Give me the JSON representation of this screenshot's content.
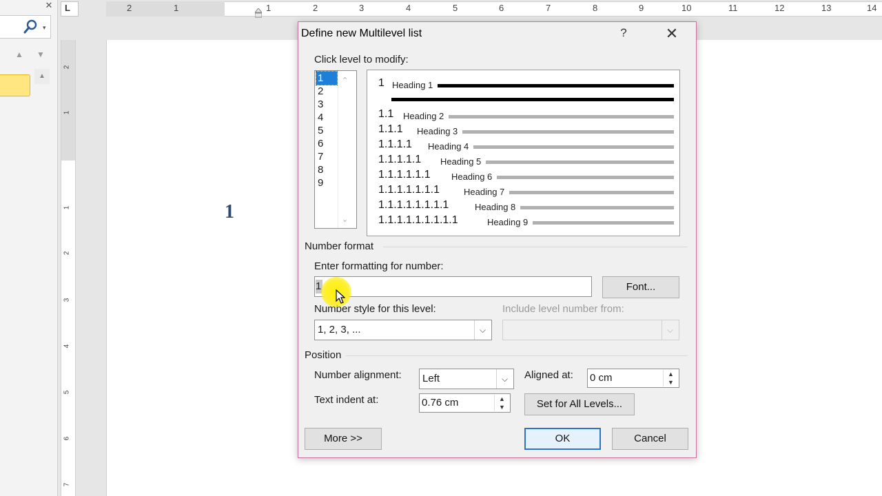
{
  "nav": {
    "close_glyph": "✕",
    "search_arrow": "▾",
    "up_glyph": "▲",
    "down_glyph": "▼",
    "scroll_up_glyph": "▲"
  },
  "ruler": {
    "corner_glyph": "L",
    "horizontal_numbers": [
      "2",
      "1",
      "1",
      "2",
      "3",
      "4",
      "5",
      "6",
      "7",
      "8",
      "9",
      "10",
      "11",
      "12",
      "13",
      "14"
    ],
    "vertical_numbers": [
      "2",
      "1",
      "1",
      "2",
      "3",
      "4",
      "5",
      "6",
      "7"
    ]
  },
  "document": {
    "heading_number": "1"
  },
  "dialog": {
    "title": "Define new Multilevel list",
    "help_glyph": "?",
    "close_glyph": "✕",
    "click_level_label": "Click level to modify:",
    "levels": [
      "1",
      "2",
      "3",
      "4",
      "5",
      "6",
      "7",
      "8",
      "9"
    ],
    "selected_level": "1",
    "scroll_up_glyph": "⌃",
    "scroll_down_glyph": "⌄",
    "preview": [
      {
        "number": "1",
        "heading": "Heading 1"
      },
      {
        "number": "1.1",
        "heading": "Heading 2"
      },
      {
        "number": "1.1.1",
        "heading": "Heading 3"
      },
      {
        "number": "1.1.1.1",
        "heading": "Heading 4"
      },
      {
        "number": "1.1.1.1.1",
        "heading": "Heading 5"
      },
      {
        "number": "1.1.1.1.1.1",
        "heading": "Heading 6"
      },
      {
        "number": "1.1.1.1.1.1.1",
        "heading": "Heading 7"
      },
      {
        "number": "1.1.1.1.1.1.1.1",
        "heading": "Heading 8"
      },
      {
        "number": "1.1.1.1.1.1.1.1.1",
        "heading": "Heading 9"
      }
    ],
    "number_format_section": "Number format",
    "enter_formatting_label": "Enter formatting for number:",
    "formatting_value": "1",
    "font_button": "Font...",
    "number_style_label": "Number style for this level:",
    "number_style_value": "1, 2, 3, ...",
    "include_level_label": "Include level number from:",
    "include_level_value": "",
    "position_section": "Position",
    "number_alignment_label": "Number alignment:",
    "number_alignment_value": "Left",
    "aligned_at_label": "Aligned at:",
    "aligned_at_value": "0 cm",
    "text_indent_label": "Text indent at:",
    "text_indent_value": "0.76 cm",
    "set_all_levels_button": "Set for All Levels...",
    "more_button": "More >>",
    "ok_button": "OK",
    "cancel_button": "Cancel",
    "combo_arrow_glyph": "⌵",
    "spin_up_glyph": "▲",
    "spin_down_glyph": "▼"
  }
}
